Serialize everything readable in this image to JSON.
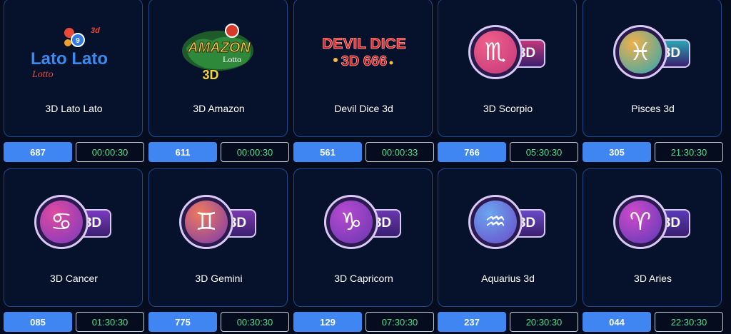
{
  "games": [
    {
      "name": "3D Lato Lato",
      "number": "687",
      "timer": "00:00:30",
      "logo": "lato-lato-logo",
      "logo_text": [
        "Lato Lato",
        "Lotto",
        "3d"
      ]
    },
    {
      "name": "3D Amazon",
      "number": "611",
      "timer": "00:00:30",
      "logo": "amazon-logo",
      "logo_text": [
        "AMAZON",
        "Lotto",
        "3D"
      ]
    },
    {
      "name": "Devil Dice 3d",
      "number": "561",
      "timer": "00:00:33",
      "logo": "devil-dice-logo",
      "logo_text": [
        "DEVIL DICE",
        "3D 666"
      ]
    },
    {
      "name": "3D Scorpio",
      "number": "766",
      "timer": "05:30:30",
      "logo": "scorpio-icon",
      "symbol": "♏",
      "badge": "3D",
      "colors": [
        "#f0608a",
        "#c2387a"
      ]
    },
    {
      "name": "Pisces 3d",
      "number": "305",
      "timer": "21:30:30",
      "logo": "pisces-icon",
      "symbol": "♓",
      "badge": "3D",
      "colors": [
        "#f2b04a",
        "#2aa6b4"
      ]
    },
    {
      "name": "3D Cancer",
      "number": "085",
      "timer": "01:30:30",
      "logo": "cancer-icon",
      "symbol": "♋",
      "badge": "3D",
      "colors": [
        "#e04aa0",
        "#7a3ac0"
      ]
    },
    {
      "name": "3D Gemini",
      "number": "775",
      "timer": "00:30:30",
      "logo": "gemini-icon",
      "symbol": "♊",
      "badge": "3D",
      "colors": [
        "#f07a5a",
        "#7a3ab0"
      ]
    },
    {
      "name": "3D Capricorn",
      "number": "129",
      "timer": "07:30:30",
      "logo": "capricorn-icon",
      "symbol": "♑",
      "badge": "3D",
      "colors": [
        "#b64ad0",
        "#6a36b0"
      ]
    },
    {
      "name": "Aquarius 3d",
      "number": "237",
      "timer": "20:30:30",
      "logo": "aquarius-icon",
      "symbol": "♒",
      "badge": "3D",
      "colors": [
        "#6aa6f0",
        "#6a4ac8"
      ]
    },
    {
      "name": "3D Aries",
      "number": "044",
      "timer": "22:30:30",
      "logo": "aries-icon",
      "symbol": "♈",
      "badge": "3D",
      "colors": [
        "#d04ac8",
        "#5a3ab8"
      ]
    }
  ],
  "colors": {
    "background": "#040c1e",
    "card": "#06112b",
    "card_border": "#1c4a8c",
    "number_bg": "#3f86f2",
    "timer_text": "#4fe08a"
  }
}
